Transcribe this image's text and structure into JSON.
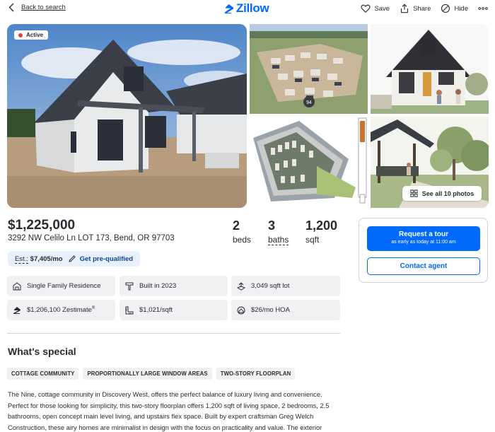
{
  "header": {
    "back_label": "Back to search",
    "logo_text": "Zillow",
    "actions": {
      "save": "Save",
      "share": "Share",
      "hide": "Hide"
    }
  },
  "gallery": {
    "status_badge": "Active",
    "aerial_marker": "94",
    "see_all_label": "See all 10 photos"
  },
  "listing": {
    "price": "$1,225,000",
    "address": "3292 NW Celilo Ln LOT 173, Bend, OR 97703",
    "beds": {
      "value": "2",
      "label": "beds"
    },
    "baths": {
      "value": "3",
      "label": "baths"
    },
    "sqft": {
      "value": "1,200",
      "label": "sqft"
    },
    "estimate": {
      "label": "Est.:",
      "value": "$7,405/mo",
      "prequal": "Get pre-qualified"
    }
  },
  "facts": {
    "type": "Single Family Residence",
    "built": "Built in 2023",
    "lot": "3,049 sqft lot",
    "zestimate": "$1,206,100 Zestimate",
    "zestimate_mark": "®",
    "price_per_sqft": "$1,021/sqft",
    "hoa": "$26/mo HOA"
  },
  "special": {
    "title": "What's special",
    "tags": [
      "COTTAGE COMMUNITY",
      "PROPORTIONALLY LARGE WINDOW AREAS",
      "TWO-STORY FLOORPLAN"
    ],
    "description": "The Nine, cottage community in Discovery West, offers the perfect balance of luxury living and convenience. Perfect for those looking for simplicity, this two-story floorplan offers 1,200 sqft of living space, 2 bedrooms, 2.5 bathrooms, open concept main level living, and upstairs flex space. Built by expert craftsman Greg Welch Construction, these airy homes are minimalist in design with the focus on practicality and value. The exterior"
  },
  "contact": {
    "tour_label": "Request a tour",
    "tour_sub": "as early as today at 11:00 am",
    "agent_label": "Contact agent"
  },
  "colors": {
    "brand": "#006aff",
    "active_dot": "#e64040",
    "chip_bg": "#f1f1f4"
  }
}
